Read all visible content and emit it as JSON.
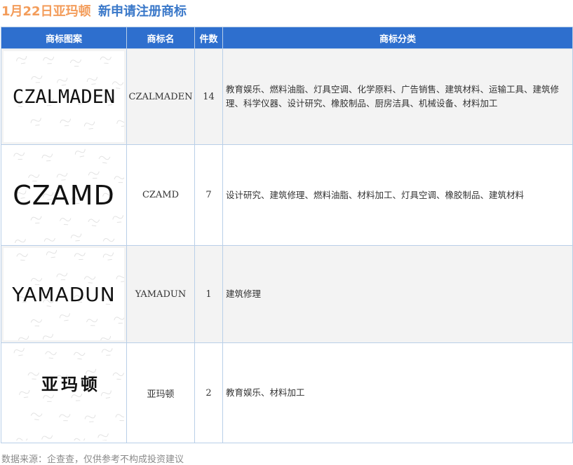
{
  "header": {
    "date_title": "1月22日亚玛顿",
    "subtitle": "新申请注册商标"
  },
  "table": {
    "columns": [
      "商标图案",
      "商标名",
      "件数",
      "商标分类"
    ],
    "rows": [
      {
        "logo_text": "CZALMADEN",
        "name": "CZALMADEN",
        "count": "14",
        "classes": "教育娱乐、燃料油脂、灯具空调、化学原料、广告销售、建筑材料、运输工具、建筑修理、科学仪器、设计研究、橡胶制品、厨房洁具、机械设备、材料加工"
      },
      {
        "logo_text": "CZAMD",
        "name": "CZAMD",
        "count": "7",
        "classes": "设计研究、建筑修理、燃料油脂、材料加工、灯具空调、橡胶制品、建筑材料"
      },
      {
        "logo_text": "YAMADUN",
        "name": "YAMADUN",
        "count": "1",
        "classes": "建筑修理"
      },
      {
        "logo_text": "亚玛顿",
        "name": "亚玛顿",
        "count": "2",
        "classes": "教育娱乐、材料加工"
      }
    ]
  },
  "footer": {
    "source": "数据来源：企查查，仅供参考不构成投资建议"
  },
  "colors": {
    "date_title": "#f39c5a",
    "subtitle": "#3a78c9",
    "header_bg": "#2e6fce",
    "row_alt_bg": "#f3f3f3"
  }
}
